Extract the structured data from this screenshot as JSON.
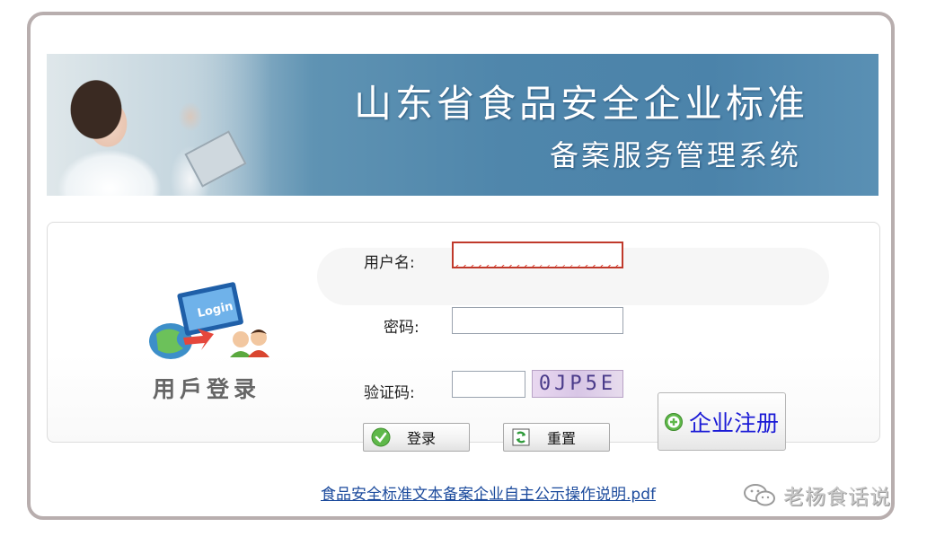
{
  "banner": {
    "title_line1": "山东省食品安全企业标准",
    "title_line2": "备案服务管理系统"
  },
  "login_art": {
    "screen_text": "Login",
    "caption": "用戶登录",
    "icon": "login-illustration-icon"
  },
  "form": {
    "username_label": "用户名:",
    "username_value": "",
    "password_label": "密码:",
    "password_value": "",
    "captcha_label": "验证码:",
    "captcha_value": "",
    "captcha_image_text": "0JP5E"
  },
  "buttons": {
    "login_label": "登录",
    "login_icon": "check-circle-icon",
    "reset_label": "重置",
    "reset_icon": "refresh-icon",
    "register_label": "企业注册",
    "register_icon": "plus-circle-icon"
  },
  "doc_link": {
    "label": "食品安全标准文本备案企业自主公示操作说明.pdf"
  },
  "watermark": {
    "text": "老杨食话说",
    "icon": "wechat-icon"
  },
  "colors": {
    "banner_blue": "#4f86ab",
    "link_blue": "#1b4a9c",
    "register_blue": "#1a1ad6",
    "error_red": "#c0392b"
  }
}
